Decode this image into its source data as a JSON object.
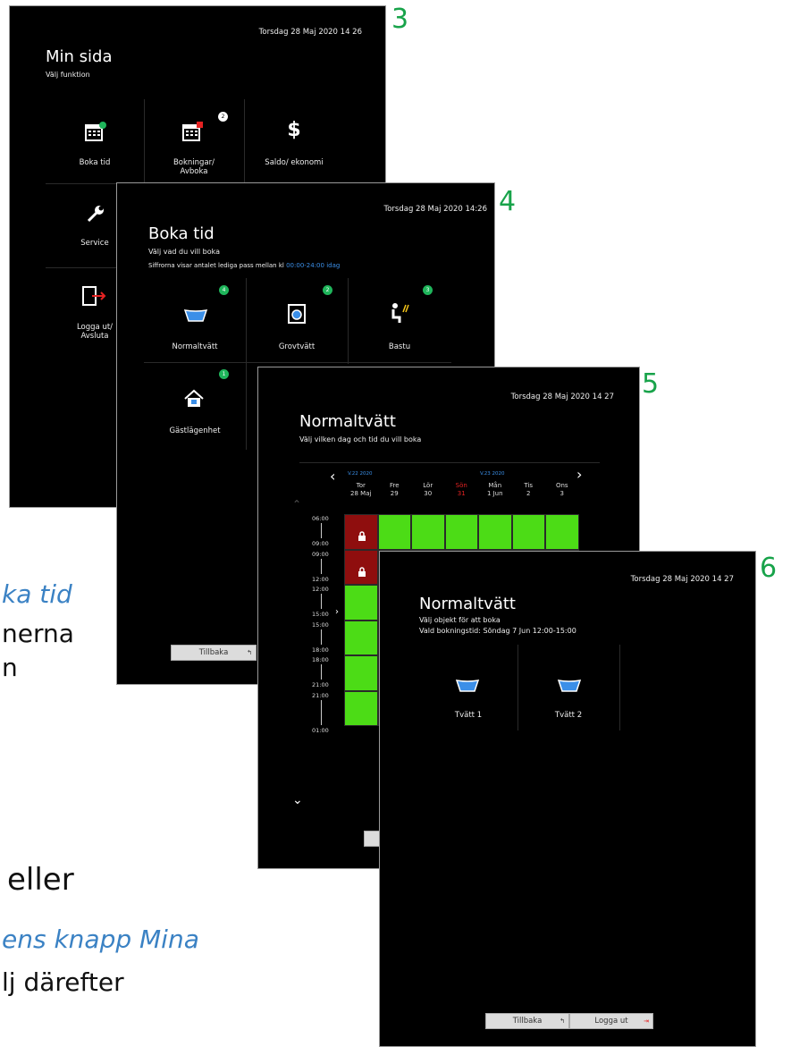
{
  "steps": [
    "3",
    "4",
    "5",
    "6"
  ],
  "bg_text": {
    "l1": "ka tid",
    "l2": "nerna",
    "l3": "n",
    "l4": "eller",
    "l5": "ens knapp Mina",
    "l6": "lj därefter"
  },
  "s3": {
    "date": "Torsdag 28 Maj 2020  14 26",
    "title": "Min sida",
    "subtitle": "Välj funktion",
    "tiles": {
      "boka": "Boka tid",
      "bokningar": "Bokningar/",
      "avboka": "Avboka",
      "saldo": "Saldo/ ekonomi",
      "service": "Service",
      "logga": "Logga ut/",
      "avsluta": "Avsluta",
      "badge": "2"
    }
  },
  "s4": {
    "date": "Torsdag 28 Maj 2020  14:26",
    "title": "Boka tid",
    "subtitle": "Välj vad du vill boka",
    "info": "Siffrorna visar antalet lediga pass mellan kl",
    "info_time": "00:00-24:00 idag",
    "tiles": [
      {
        "label": "Normaltvätt",
        "badge": "4"
      },
      {
        "label": "Grovtvätt",
        "badge": "2"
      },
      {
        "label": "Bastu",
        "badge": "3"
      },
      {
        "label": "Gästlägenhet",
        "badge": "1"
      }
    ],
    "back": "Tillbaka"
  },
  "s5": {
    "date": "Torsdag 28 Maj 2020  14 27",
    "title": "Normaltvätt",
    "subtitle": "Välj vilken dag och tid du vill boka",
    "week1": "V.22 2020",
    "week2": "V.23 2020",
    "days": [
      {
        "d": "Tor",
        "n": "28 Maj"
      },
      {
        "d": "Fre",
        "n": "29"
      },
      {
        "d": "Lör",
        "n": "30"
      },
      {
        "d": "Sön",
        "n": "31"
      },
      {
        "d": "Mån",
        "n": "1 Jun"
      },
      {
        "d": "Tis",
        "n": "2"
      },
      {
        "d": "Ons",
        "n": "3"
      }
    ],
    "times": [
      [
        "06:00",
        "09:00"
      ],
      [
        "09:00",
        "12:00"
      ],
      [
        "12:00",
        "15:00"
      ],
      [
        "15:00",
        "18:00"
      ],
      [
        "18:00",
        "21:00"
      ],
      [
        "21:00",
        "01:00"
      ]
    ],
    "sunday_color": "#e52222",
    "slot_green": "#4cdc16",
    "slot_red": "#8f0e0e"
  },
  "s6": {
    "date": "Torsdag 28 Maj 2020  14 27",
    "title": "Normaltvätt",
    "subtitle": "Välj objekt för att boka",
    "booking": "Vald bokningstid: Söndag 7 Jun 12:00-15:00",
    "objects": [
      "Tvätt 1",
      "Tvätt 2"
    ],
    "back": "Tillbaka",
    "logout": "Logga ut"
  }
}
